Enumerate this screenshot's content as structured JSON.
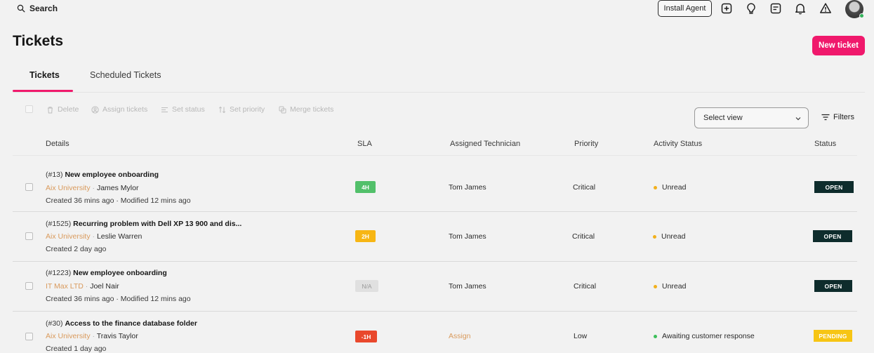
{
  "topbar": {
    "search_label": "Search",
    "install_agent_label": "Install Agent",
    "icons": [
      "plus-square-icon",
      "lightbulb-icon",
      "notes-icon",
      "bell-icon",
      "warning-icon"
    ]
  },
  "page": {
    "title": "Tickets",
    "new_ticket_label": "New ticket"
  },
  "tabs": [
    {
      "label": "Tickets",
      "active": true
    },
    {
      "label": "Scheduled Tickets",
      "active": false
    }
  ],
  "bulk_actions": {
    "delete": "Delete",
    "assign": "Assign tickets",
    "set_status": "Set status",
    "set_priority": "Set priority",
    "merge": "Merge tickets"
  },
  "select_view": {
    "value": "Select view"
  },
  "filters_label": "Filters",
  "columns": {
    "details": "Details",
    "sla": "SLA",
    "technician": "Assigned Technician",
    "priority": "Priority",
    "activity": "Activity Status",
    "status": "Status"
  },
  "rows": [
    {
      "number": "(#13)",
      "title": "New employee onboarding",
      "org": "Aix University",
      "separator": "·",
      "requester": "James Mylor",
      "meta": "Created 36 mins ago · Modified 12 mins ago",
      "sla": "4H",
      "technician": "Tom James",
      "priority": "Critical",
      "activity": "Unread",
      "status": "OPEN"
    },
    {
      "number": "(#1525)",
      "title": "Recurring problem with Dell XP 13 900 and dis...",
      "org": "Aix University",
      "separator": "·",
      "requester": "Leslie Warren",
      "meta": "Created 2 day ago",
      "sla": "2H",
      "technician": "Tom James",
      "priority": "Critical",
      "activity": "Unread",
      "status": "OPEN"
    },
    {
      "number": "(#1223)",
      "title": "New employee onboarding",
      "org": "IT Max LTD",
      "separator": "·",
      "requester": "Joel Nair",
      "meta": "Created 36 mins ago · Modified 12 mins ago",
      "sla": "N/A",
      "technician": "Tom James",
      "priority": "Critical",
      "activity": "Unread",
      "status": "OPEN"
    },
    {
      "number": "(#30)",
      "title": "Access to the finance database folder",
      "org": "Aix University",
      "separator": "·",
      "requester": "Travis Taylor",
      "meta": "Created 1 day ago",
      "sla": "-1H",
      "technician": "Assign",
      "priority": "Low",
      "activity": "Awaiting customer response",
      "status": "PENDING"
    }
  ],
  "colors": {
    "accent": "#f0196c",
    "sla_green": "#52c06a",
    "sla_amber": "#f7b614",
    "sla_na": "#e0e0e0",
    "sla_red": "#e9482c",
    "status_open": "#0e2c2c",
    "status_pending": "#f7c514",
    "dot_unread": "#f2b01c",
    "dot_awaiting": "#3cbf5a",
    "link_orange": "#d99a5c"
  }
}
